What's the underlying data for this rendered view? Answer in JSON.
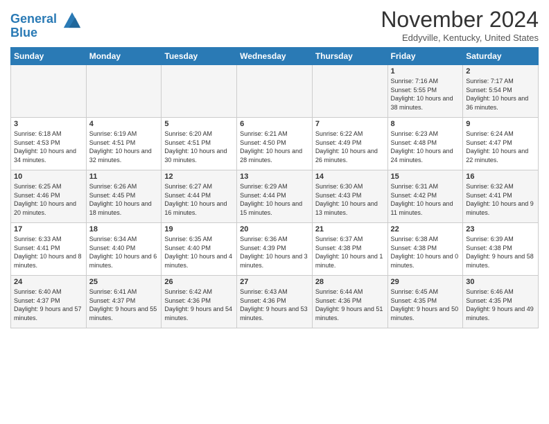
{
  "header": {
    "logo_line1": "General",
    "logo_line2": "Blue",
    "month_title": "November 2024",
    "location": "Eddyville, Kentucky, United States"
  },
  "days_of_week": [
    "Sunday",
    "Monday",
    "Tuesday",
    "Wednesday",
    "Thursday",
    "Friday",
    "Saturday"
  ],
  "weeks": [
    [
      {
        "day": "",
        "info": ""
      },
      {
        "day": "",
        "info": ""
      },
      {
        "day": "",
        "info": ""
      },
      {
        "day": "",
        "info": ""
      },
      {
        "day": "",
        "info": ""
      },
      {
        "day": "1",
        "info": "Sunrise: 7:16 AM\nSunset: 5:55 PM\nDaylight: 10 hours and 38 minutes."
      },
      {
        "day": "2",
        "info": "Sunrise: 7:17 AM\nSunset: 5:54 PM\nDaylight: 10 hours and 36 minutes."
      }
    ],
    [
      {
        "day": "3",
        "info": "Sunrise: 6:18 AM\nSunset: 4:53 PM\nDaylight: 10 hours and 34 minutes."
      },
      {
        "day": "4",
        "info": "Sunrise: 6:19 AM\nSunset: 4:51 PM\nDaylight: 10 hours and 32 minutes."
      },
      {
        "day": "5",
        "info": "Sunrise: 6:20 AM\nSunset: 4:51 PM\nDaylight: 10 hours and 30 minutes."
      },
      {
        "day": "6",
        "info": "Sunrise: 6:21 AM\nSunset: 4:50 PM\nDaylight: 10 hours and 28 minutes."
      },
      {
        "day": "7",
        "info": "Sunrise: 6:22 AM\nSunset: 4:49 PM\nDaylight: 10 hours and 26 minutes."
      },
      {
        "day": "8",
        "info": "Sunrise: 6:23 AM\nSunset: 4:48 PM\nDaylight: 10 hours and 24 minutes."
      },
      {
        "day": "9",
        "info": "Sunrise: 6:24 AM\nSunset: 4:47 PM\nDaylight: 10 hours and 22 minutes."
      }
    ],
    [
      {
        "day": "10",
        "info": "Sunrise: 6:25 AM\nSunset: 4:46 PM\nDaylight: 10 hours and 20 minutes."
      },
      {
        "day": "11",
        "info": "Sunrise: 6:26 AM\nSunset: 4:45 PM\nDaylight: 10 hours and 18 minutes."
      },
      {
        "day": "12",
        "info": "Sunrise: 6:27 AM\nSunset: 4:44 PM\nDaylight: 10 hours and 16 minutes."
      },
      {
        "day": "13",
        "info": "Sunrise: 6:29 AM\nSunset: 4:44 PM\nDaylight: 10 hours and 15 minutes."
      },
      {
        "day": "14",
        "info": "Sunrise: 6:30 AM\nSunset: 4:43 PM\nDaylight: 10 hours and 13 minutes."
      },
      {
        "day": "15",
        "info": "Sunrise: 6:31 AM\nSunset: 4:42 PM\nDaylight: 10 hours and 11 minutes."
      },
      {
        "day": "16",
        "info": "Sunrise: 6:32 AM\nSunset: 4:41 PM\nDaylight: 10 hours and 9 minutes."
      }
    ],
    [
      {
        "day": "17",
        "info": "Sunrise: 6:33 AM\nSunset: 4:41 PM\nDaylight: 10 hours and 8 minutes."
      },
      {
        "day": "18",
        "info": "Sunrise: 6:34 AM\nSunset: 4:40 PM\nDaylight: 10 hours and 6 minutes."
      },
      {
        "day": "19",
        "info": "Sunrise: 6:35 AM\nSunset: 4:40 PM\nDaylight: 10 hours and 4 minutes."
      },
      {
        "day": "20",
        "info": "Sunrise: 6:36 AM\nSunset: 4:39 PM\nDaylight: 10 hours and 3 minutes."
      },
      {
        "day": "21",
        "info": "Sunrise: 6:37 AM\nSunset: 4:38 PM\nDaylight: 10 hours and 1 minute."
      },
      {
        "day": "22",
        "info": "Sunrise: 6:38 AM\nSunset: 4:38 PM\nDaylight: 10 hours and 0 minutes."
      },
      {
        "day": "23",
        "info": "Sunrise: 6:39 AM\nSunset: 4:38 PM\nDaylight: 9 hours and 58 minutes."
      }
    ],
    [
      {
        "day": "24",
        "info": "Sunrise: 6:40 AM\nSunset: 4:37 PM\nDaylight: 9 hours and 57 minutes."
      },
      {
        "day": "25",
        "info": "Sunrise: 6:41 AM\nSunset: 4:37 PM\nDaylight: 9 hours and 55 minutes."
      },
      {
        "day": "26",
        "info": "Sunrise: 6:42 AM\nSunset: 4:36 PM\nDaylight: 9 hours and 54 minutes."
      },
      {
        "day": "27",
        "info": "Sunrise: 6:43 AM\nSunset: 4:36 PM\nDaylight: 9 hours and 53 minutes."
      },
      {
        "day": "28",
        "info": "Sunrise: 6:44 AM\nSunset: 4:36 PM\nDaylight: 9 hours and 51 minutes."
      },
      {
        "day": "29",
        "info": "Sunrise: 6:45 AM\nSunset: 4:35 PM\nDaylight: 9 hours and 50 minutes."
      },
      {
        "day": "30",
        "info": "Sunrise: 6:46 AM\nSunset: 4:35 PM\nDaylight: 9 hours and 49 minutes."
      }
    ]
  ]
}
